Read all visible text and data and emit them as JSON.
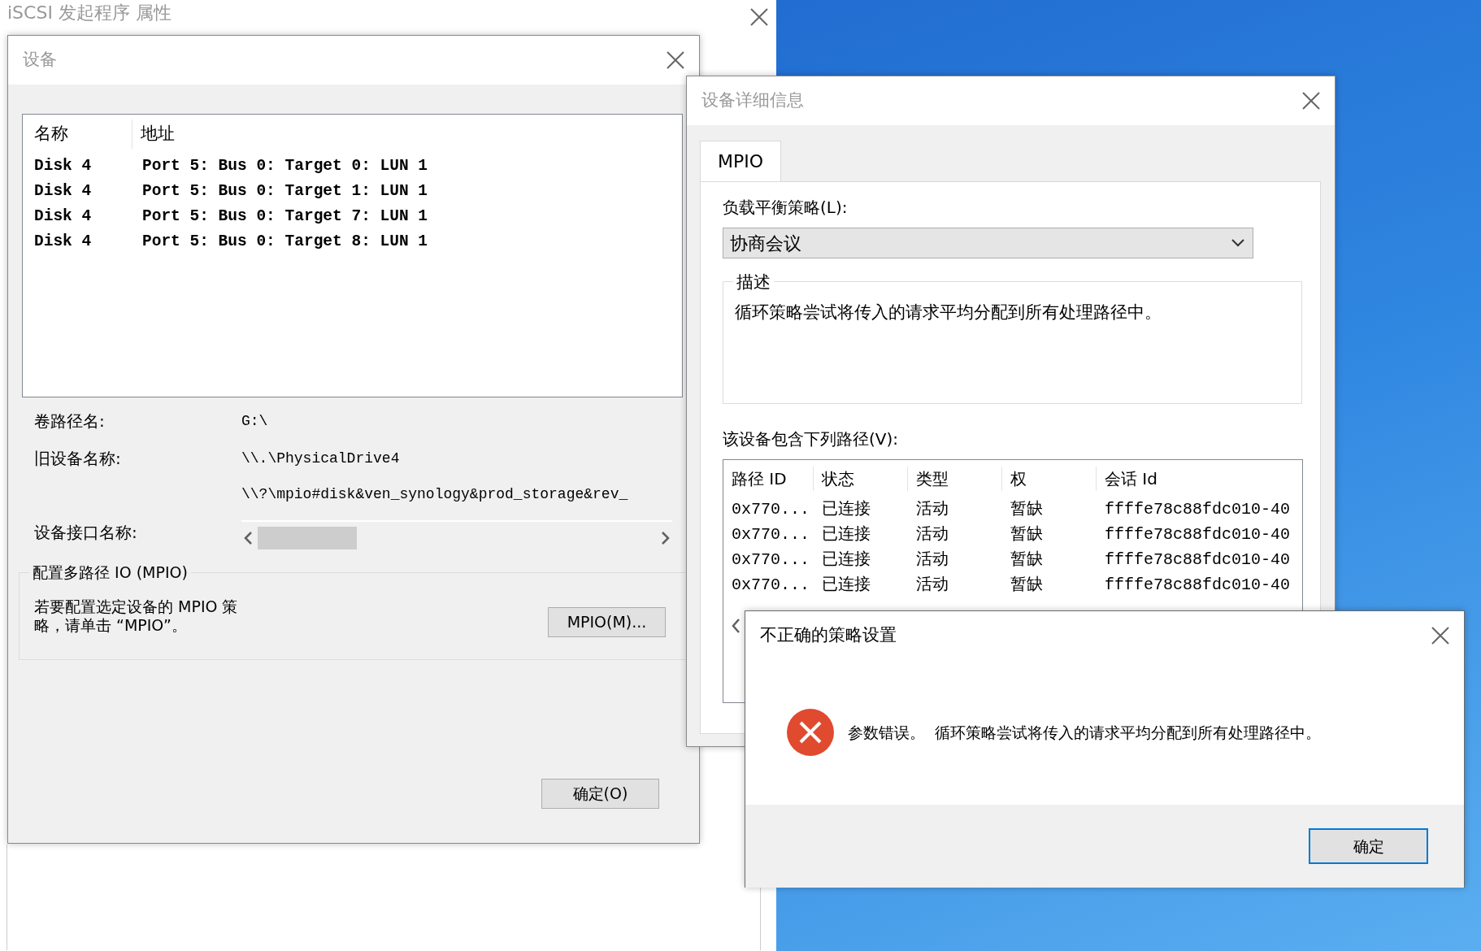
{
  "background_window": {
    "title": "iSCSI 发起程序 属性"
  },
  "devices_dialog": {
    "title": "设备",
    "columns": [
      "名称",
      "地址"
    ],
    "rows": [
      {
        "name": "Disk 4",
        "address": "Port 5: Bus 0: Target 0: LUN 1"
      },
      {
        "name": "Disk 4",
        "address": "Port 5: Bus 0: Target 1: LUN 1"
      },
      {
        "name": "Disk 4",
        "address": "Port 5: Bus 0: Target 7: LUN 1"
      },
      {
        "name": "Disk 4",
        "address": "Port 5: Bus 0: Target 8: LUN 1"
      }
    ],
    "fields": [
      {
        "label": "卷路径名:",
        "value": "G:\\"
      },
      {
        "label": "旧设备名称:",
        "value": "\\\\.\\PhysicalDrive4"
      },
      {
        "label": "设备接口名称:",
        "value": "\\\\?\\mpio#disk&ven_synology&prod_storage&rev_",
        "kind": "scroll"
      }
    ],
    "mpio_group": {
      "title": "配置多路径 IO (MPIO)",
      "text": "若要配置选定设备的 MPIO 策略，请单击 “MPIO”。",
      "button": "MPIO(M)..."
    },
    "ok_button": "确定(O)"
  },
  "details_dialog": {
    "title": "设备详细信息",
    "tabs": [
      {
        "label": "MPIO",
        "selected": true
      }
    ],
    "policy_label": "负载平衡策略(L):",
    "policy_value": "协商会议",
    "description_title": "描述",
    "description": "循环策略尝试将传入的请求平均分配到所有处理路径中。",
    "paths_label": "该设备包含下列路径(V):",
    "columns": [
      "路径 ID",
      "状态",
      "类型",
      "权",
      "会话 Id"
    ],
    "rows": [
      {
        "path_id": "0x770...",
        "status": "已连接",
        "type": "活动",
        "weight": "暂缺",
        "session_id": "ffffe78c88fdc010-40"
      },
      {
        "path_id": "0x770...",
        "status": "已连接",
        "type": "活动",
        "weight": "暂缺",
        "session_id": "ffffe78c88fdc010-40"
      },
      {
        "path_id": "0x770...",
        "status": "已连接",
        "type": "活动",
        "weight": "暂缺",
        "session_id": "ffffe78c88fdc010-40"
      },
      {
        "path_id": "0x770...",
        "status": "已连接",
        "type": "活动",
        "weight": "暂缺",
        "session_id": "ffffe78c88fdc010-40"
      }
    ]
  },
  "error_dialog": {
    "title": "不正确的策略设置",
    "message": "参数错误。  循环策略尝试将传入的请求平均分配到所有处理路径中。",
    "ok_button": {
      "label": "确定",
      "focused": true
    }
  }
}
